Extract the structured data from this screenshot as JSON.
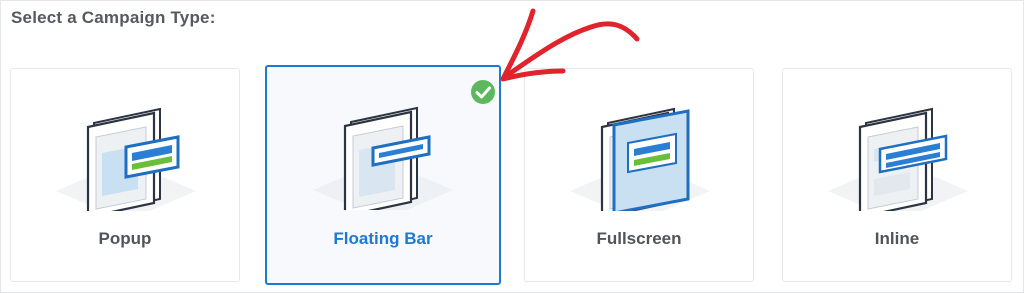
{
  "heading": "Select a Campaign Type:",
  "campaign_types": [
    {
      "label": "Popup",
      "selected": false,
      "icon": "popup-window-icon"
    },
    {
      "label": "Floating Bar",
      "selected": true,
      "icon": "floating-bar-window-icon"
    },
    {
      "label": "Fullscreen",
      "selected": false,
      "icon": "fullscreen-window-icon"
    },
    {
      "label": "Inline",
      "selected": false,
      "icon": "inline-window-icon"
    }
  ],
  "selected_indicator_icon": "check-circle-icon",
  "annotation_icon": "red-arrow-icon",
  "colors": {
    "accent": "#1e7ad1",
    "check_green": "#5cb85c",
    "annotation_red": "#e0232d",
    "heading": "#555a60",
    "label": "#50555b"
  }
}
